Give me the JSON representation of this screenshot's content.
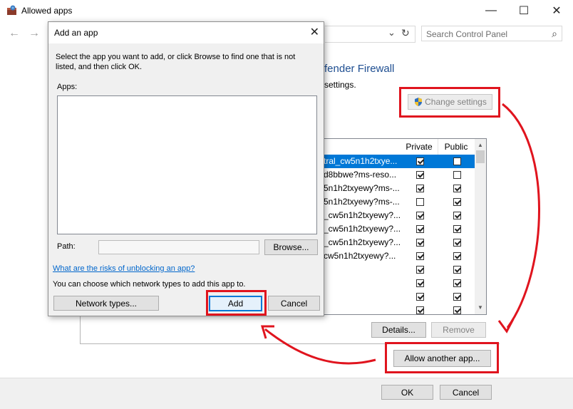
{
  "window": {
    "title": "Allowed apps",
    "minimize": "—",
    "maximize": "☐",
    "close": "✕"
  },
  "nav": {
    "back": "←",
    "forward": "→",
    "dropdown": "⌄",
    "refresh": "↻"
  },
  "search": {
    "placeholder": "Search Control Panel",
    "icon": "⌕"
  },
  "main": {
    "heading_fragment": "fender Firewall",
    "subtext_fragment": "settings.",
    "change_settings_label": "Change settings",
    "columns": {
      "private": "Private",
      "public": "Public"
    },
    "rows": [
      {
        "name": "tral_cw5n1h2txye...",
        "private": true,
        "public": false,
        "selected": true
      },
      {
        "name": "d8bbwe?ms-reso...",
        "private": true,
        "public": false
      },
      {
        "name": "5n1h2txyewy?ms-...",
        "private": true,
        "public": true
      },
      {
        "name": "5n1h2txyewy?ms-...",
        "private": false,
        "public": true
      },
      {
        "name": "_cw5n1h2txyewy?...",
        "private": true,
        "public": true
      },
      {
        "name": "_cw5n1h2txyewy?...",
        "private": true,
        "public": true
      },
      {
        "name": "_cw5n1h2txyewy?...",
        "private": true,
        "public": true
      },
      {
        "name": "cw5n1h2txyewy?...",
        "private": true,
        "public": true
      },
      {
        "name": "",
        "private": true,
        "public": true
      },
      {
        "name": "",
        "private": true,
        "public": true
      },
      {
        "name": "",
        "private": true,
        "public": true
      },
      {
        "name": "",
        "private": true,
        "public": true
      }
    ],
    "details_label": "Details...",
    "remove_label": "Remove",
    "allow_another_label": "Allow another app..."
  },
  "footer": {
    "ok_label": "OK",
    "cancel_label": "Cancel"
  },
  "dialog": {
    "title": "Add an app",
    "close": "✕",
    "instructions": "Select the app you want to add, or click Browse to find one that is not listed, and then click OK.",
    "apps_label": "Apps:",
    "path_label": "Path:",
    "browse_label": "Browse...",
    "risk_link": "What are the risks of unblocking an app?",
    "network_note": "You can choose which network types to add this app to.",
    "network_types_label": "Network types...",
    "add_label": "Add",
    "cancel_label": "Cancel"
  },
  "colors": {
    "annotation_red": "#e0141e",
    "selection_blue": "#0078d7",
    "link_blue": "#0066cc"
  }
}
